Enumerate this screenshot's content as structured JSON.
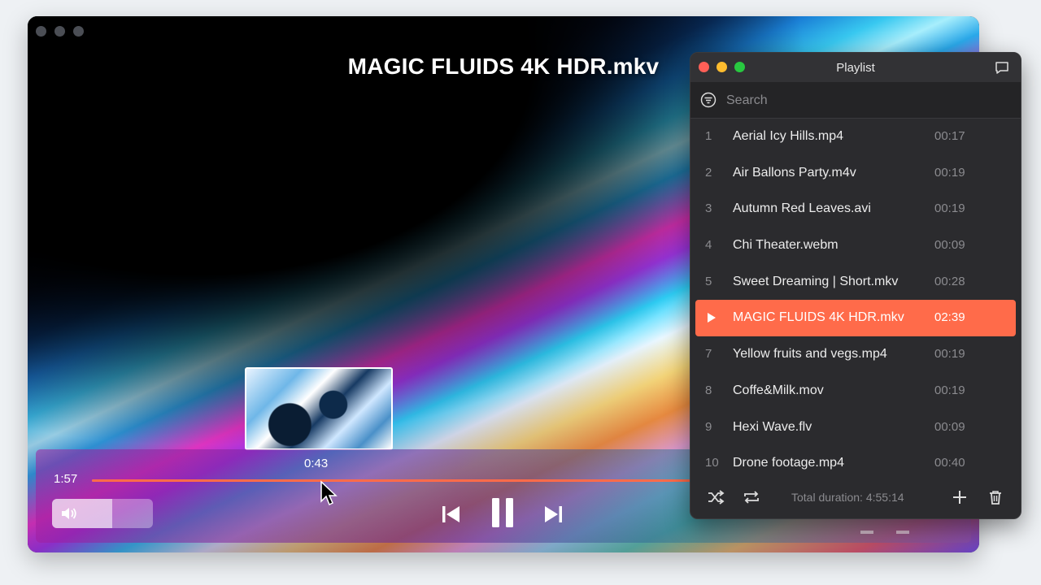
{
  "player": {
    "title": "MAGIC FLUIDS 4K HDR.mkv",
    "current_time": "1:57",
    "hover_time": "0:43",
    "progress_fraction": 0.74,
    "volume_fraction": 0.6
  },
  "playlist": {
    "title": "Playlist",
    "search_placeholder": "Search",
    "items": [
      {
        "num": "1",
        "name": "Aerial Icy Hills.mp4",
        "duration": "00:17"
      },
      {
        "num": "2",
        "name": "Air Ballons Party.m4v",
        "duration": "00:19"
      },
      {
        "num": "3",
        "name": "Autumn Red Leaves.avi",
        "duration": "00:19"
      },
      {
        "num": "4",
        "name": "Chi Theater.webm",
        "duration": "00:09"
      },
      {
        "num": "5",
        "name": "Sweet Dreaming | Short.mkv",
        "duration": "00:28"
      },
      {
        "num": "6",
        "name": "MAGIC FLUIDS 4K HDR.mkv",
        "duration": "02:39",
        "active": true
      },
      {
        "num": "7",
        "name": "Yellow fruits and vegs.mp4",
        "duration": "00:19"
      },
      {
        "num": "8",
        "name": "Coffe&Milk.mov",
        "duration": "00:19"
      },
      {
        "num": "9",
        "name": "Hexi Wave.flv",
        "duration": "00:09"
      },
      {
        "num": "10",
        "name": "Drone footage.mp4",
        "duration": "00:40"
      }
    ],
    "total_duration": "Total duration: 4:55:14"
  },
  "colors": {
    "accent": "#ff6b4a",
    "traffic_red": "#ff5f57",
    "traffic_yellow": "#febc2e",
    "traffic_green": "#28c840"
  },
  "icons": [
    "filter-icon",
    "chat-icon",
    "shuffle-icon",
    "repeat-icon",
    "plus-icon",
    "trash-icon",
    "volume-icon",
    "prev-icon",
    "pause-icon",
    "next-icon",
    "play-icon"
  ]
}
